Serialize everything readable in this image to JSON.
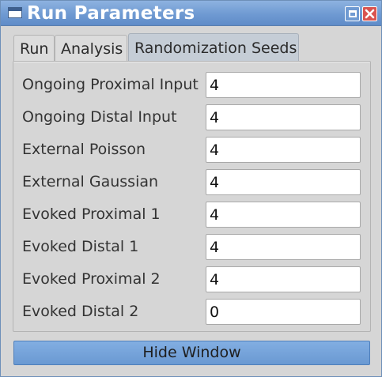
{
  "window": {
    "title": "Run Parameters"
  },
  "tabs": [
    {
      "label": "Run"
    },
    {
      "label": "Analysis"
    },
    {
      "label": "Randomization Seeds",
      "selected": true
    }
  ],
  "fields": [
    {
      "label": "Ongoing Proximal Input",
      "value": "4"
    },
    {
      "label": "Ongoing Distal Input",
      "value": "4"
    },
    {
      "label": "External Poisson",
      "value": "4"
    },
    {
      "label": "External Gaussian",
      "value": "4"
    },
    {
      "label": "Evoked Proximal 1",
      "value": "4"
    },
    {
      "label": "Evoked Distal 1",
      "value": "4"
    },
    {
      "label": "Evoked Proximal 2",
      "value": "4"
    },
    {
      "label": "Evoked Distal 2",
      "value": "0"
    }
  ],
  "footer": {
    "hide_label": "Hide Window"
  },
  "colors": {
    "titlebar": "#6f9ad2",
    "close_button": "#d9534f",
    "selected_tab": "#c5cdd6",
    "hide_button": "#6a99d2"
  }
}
